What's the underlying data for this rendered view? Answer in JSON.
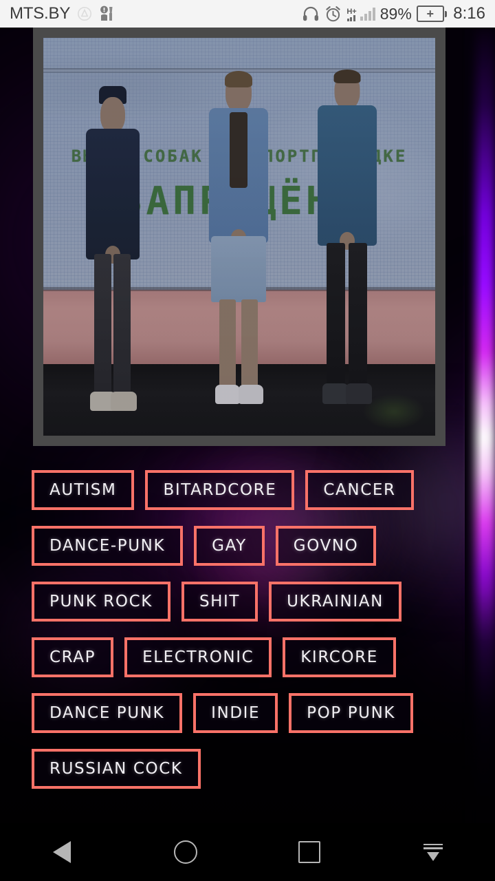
{
  "status_bar": {
    "carrier": "MTS.BY",
    "icons": [
      "no-sim-circle-icon",
      "mute-vibrate-icon",
      "headphones-icon",
      "alarm-clock-icon",
      "hplus-network-icon",
      "signal-bars-icon",
      "battery-charging-icon"
    ],
    "network_type": "H+",
    "battery_percent": "89%",
    "clock": "8:16"
  },
  "album_art": {
    "name": "band-photo-artwork",
    "wall_text_line1": "ВЫГУЛ СОБАК НА СПОРТПЛОЩАДКЕ",
    "wall_text_line2": "ЗАПРЕЩЁН!",
    "subjects": [
      "person-beanie-navy-sweater",
      "person-denim-jacket-shorts",
      "person-denim-shirt-black-jeans"
    ]
  },
  "tags": {
    "accent_color": "#fb7268",
    "text_color": "#f2f0f4",
    "rows": [
      [
        "AUTISM",
        "BITARDCORE",
        "CANCER"
      ],
      [
        "DANCE-PUNK",
        "GAY",
        "GOVNO"
      ],
      [
        "PUNK ROCK",
        "SHIT",
        "UKRAINIAN"
      ],
      [
        "CRAP",
        "ELECTRONIC",
        "KIRCORE"
      ],
      [
        "DANCE PUNK",
        "INDIE",
        "POP PUNK"
      ],
      [
        "RUSSIAN COCK"
      ]
    ]
  },
  "nav_bar": {
    "items": [
      {
        "name": "back-button",
        "icon": "triangle-left-icon"
      },
      {
        "name": "home-button",
        "icon": "circle-icon"
      },
      {
        "name": "recents-button",
        "icon": "square-icon"
      },
      {
        "name": "hide-navbar-button",
        "icon": "arrow-down-bars-icon"
      }
    ]
  }
}
